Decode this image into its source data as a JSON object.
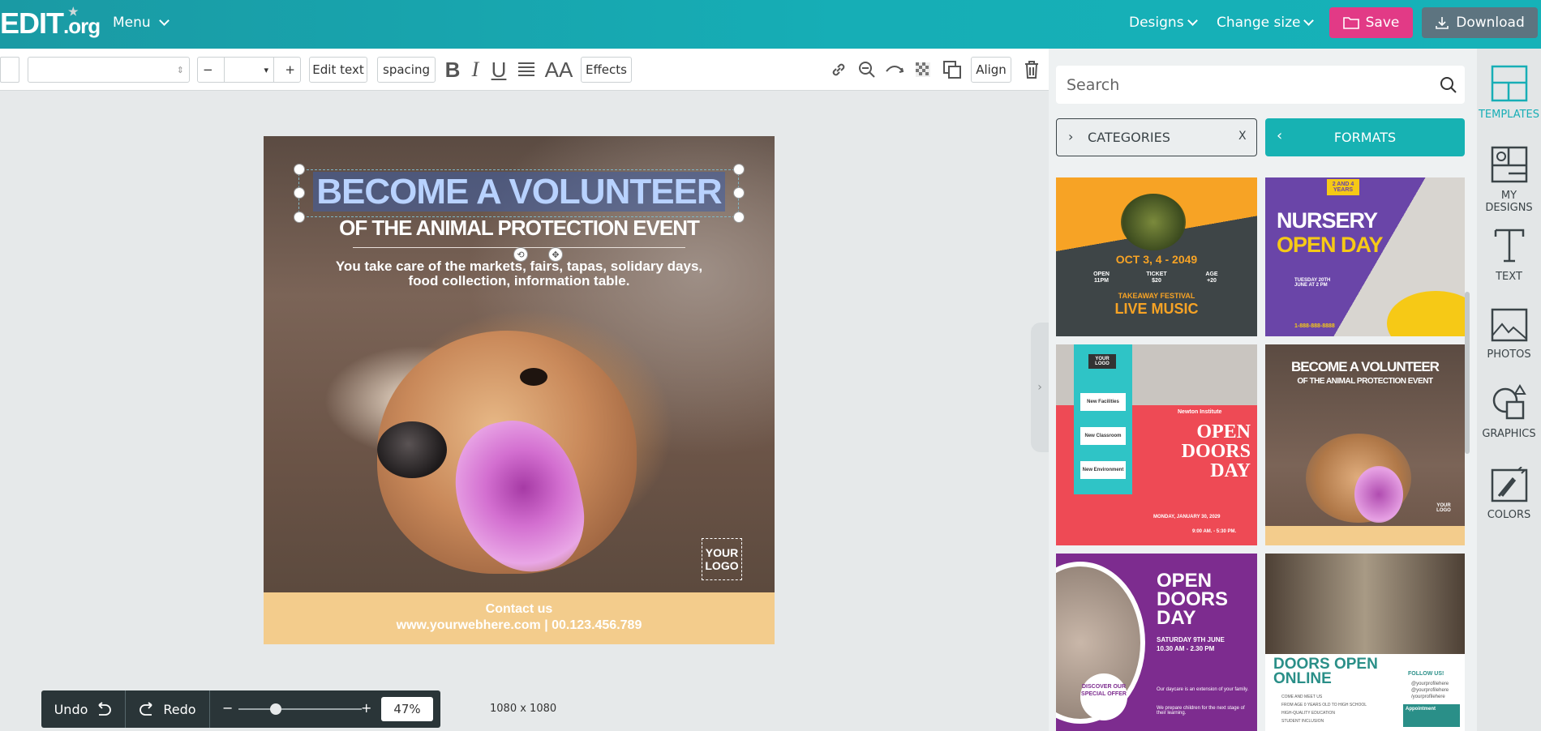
{
  "header": {
    "logo": "EDIT",
    "logo_suffix": ".org",
    "menu_label": "Menu",
    "designs_label": "Designs",
    "change_size_label": "Change size",
    "save_label": "Save",
    "download_label": "Download",
    "accent_color": "#e23a86"
  },
  "toolbar": {
    "edit_text_label": "Edit text",
    "spacing_label": "spacing",
    "effects_label": "Effects",
    "align_label": "Align",
    "bold_glyph": "B",
    "italic_glyph": "I",
    "underline_glyph": "U",
    "case_glyph": "AA",
    "minus_glyph": "−",
    "plus_glyph": "+"
  },
  "design": {
    "title_part1": "BECOME A ",
    "title_part2": "VOLUNTEER",
    "subtitle": "OF THE ANIMAL PROTECTION EVENT",
    "body": "You take care of the markets, fairs, tapas, solidary days, food collection, information table.",
    "logo_line1": "YOUR",
    "logo_line2": "LOGO",
    "contact_line1": "Contact us",
    "contact_line2": "www.yourwebhere.com | 00.123.456.789"
  },
  "canvas": {
    "dimensions": "1080 x 1080"
  },
  "bottombar": {
    "undo_label": "Undo",
    "redo_label": "Redo",
    "zoom_percent": "47%",
    "zoom_level": 0.3
  },
  "panel": {
    "search_placeholder": "Search",
    "categories_label": "CATEGORIES",
    "categories_close": "X",
    "formats_label": "FORMATS",
    "templates": [
      {
        "line1": "OCT 3, 4 - 2049",
        "line2": "TAKEAWAY FESTIVAL",
        "line3": "LIVE MUSIC",
        "col1a": "OPEN",
        "col1b": "11PM",
        "col2a": "TICKET",
        "col2b": "$20",
        "col3a": "AGE",
        "col3b": "+20"
      },
      {
        "line1": "NURSERY",
        "line2": "OPEN DAY",
        "tag": "2 AND 4 YEARS",
        "date": "TUESDAY 20TH JUNE AT 2 PM",
        "phone": "1-888-888-8888"
      },
      {
        "logo": "YOUR LOGO",
        "line1": "OPEN",
        "line2": "DOORS",
        "line3": "DAY",
        "institute": "Newton Institute",
        "item1": "New Facilities",
        "item2": "New Classroom",
        "item3": "New Environment",
        "date": "MONDAY, JANUARY 30, 2029",
        "time": "9:00 AM. - 5:30 PM."
      },
      {
        "line1": "BECOME A VOLUNTEER",
        "line2": "OF THE ANIMAL PROTECTION EVENT",
        "logo": "YOUR LOGO"
      },
      {
        "line1": "OPEN",
        "line2": "DOORS",
        "line3": "DAY",
        "date": "SATURDAY 9TH JUNE",
        "time": "10.30 AM - 2.30 PM",
        "badge": "DISCOVER OUR SPECIAL OFFER",
        "note1": "Our daycare is an extension of your family.",
        "note2": "We prepare children for the next stage of their learning."
      },
      {
        "line1": "DOORS OPEN",
        "line2": "ONLINE",
        "follow": "FOLLOW US!",
        "handle1": "@yourprofilehere",
        "handle2": "@yourprofilehere",
        "handle3": "/yourprofilehere",
        "come": "COME AND MEET US",
        "age": "FROM AGE 0 YEARS OLD TO HIGH SCHOOL",
        "edu": "HIGH-QUALITY EDUCATION",
        "incl": "STUDENT INCLUSION",
        "appt": "Appointment"
      }
    ]
  },
  "sidenav": {
    "items": [
      {
        "label": "TEMPLATES"
      },
      {
        "label": "MY DESIGNS"
      },
      {
        "label": "TEXT"
      },
      {
        "label": "PHOTOS"
      },
      {
        "label": "GRAPHICS"
      },
      {
        "label": "COLORS"
      }
    ]
  }
}
